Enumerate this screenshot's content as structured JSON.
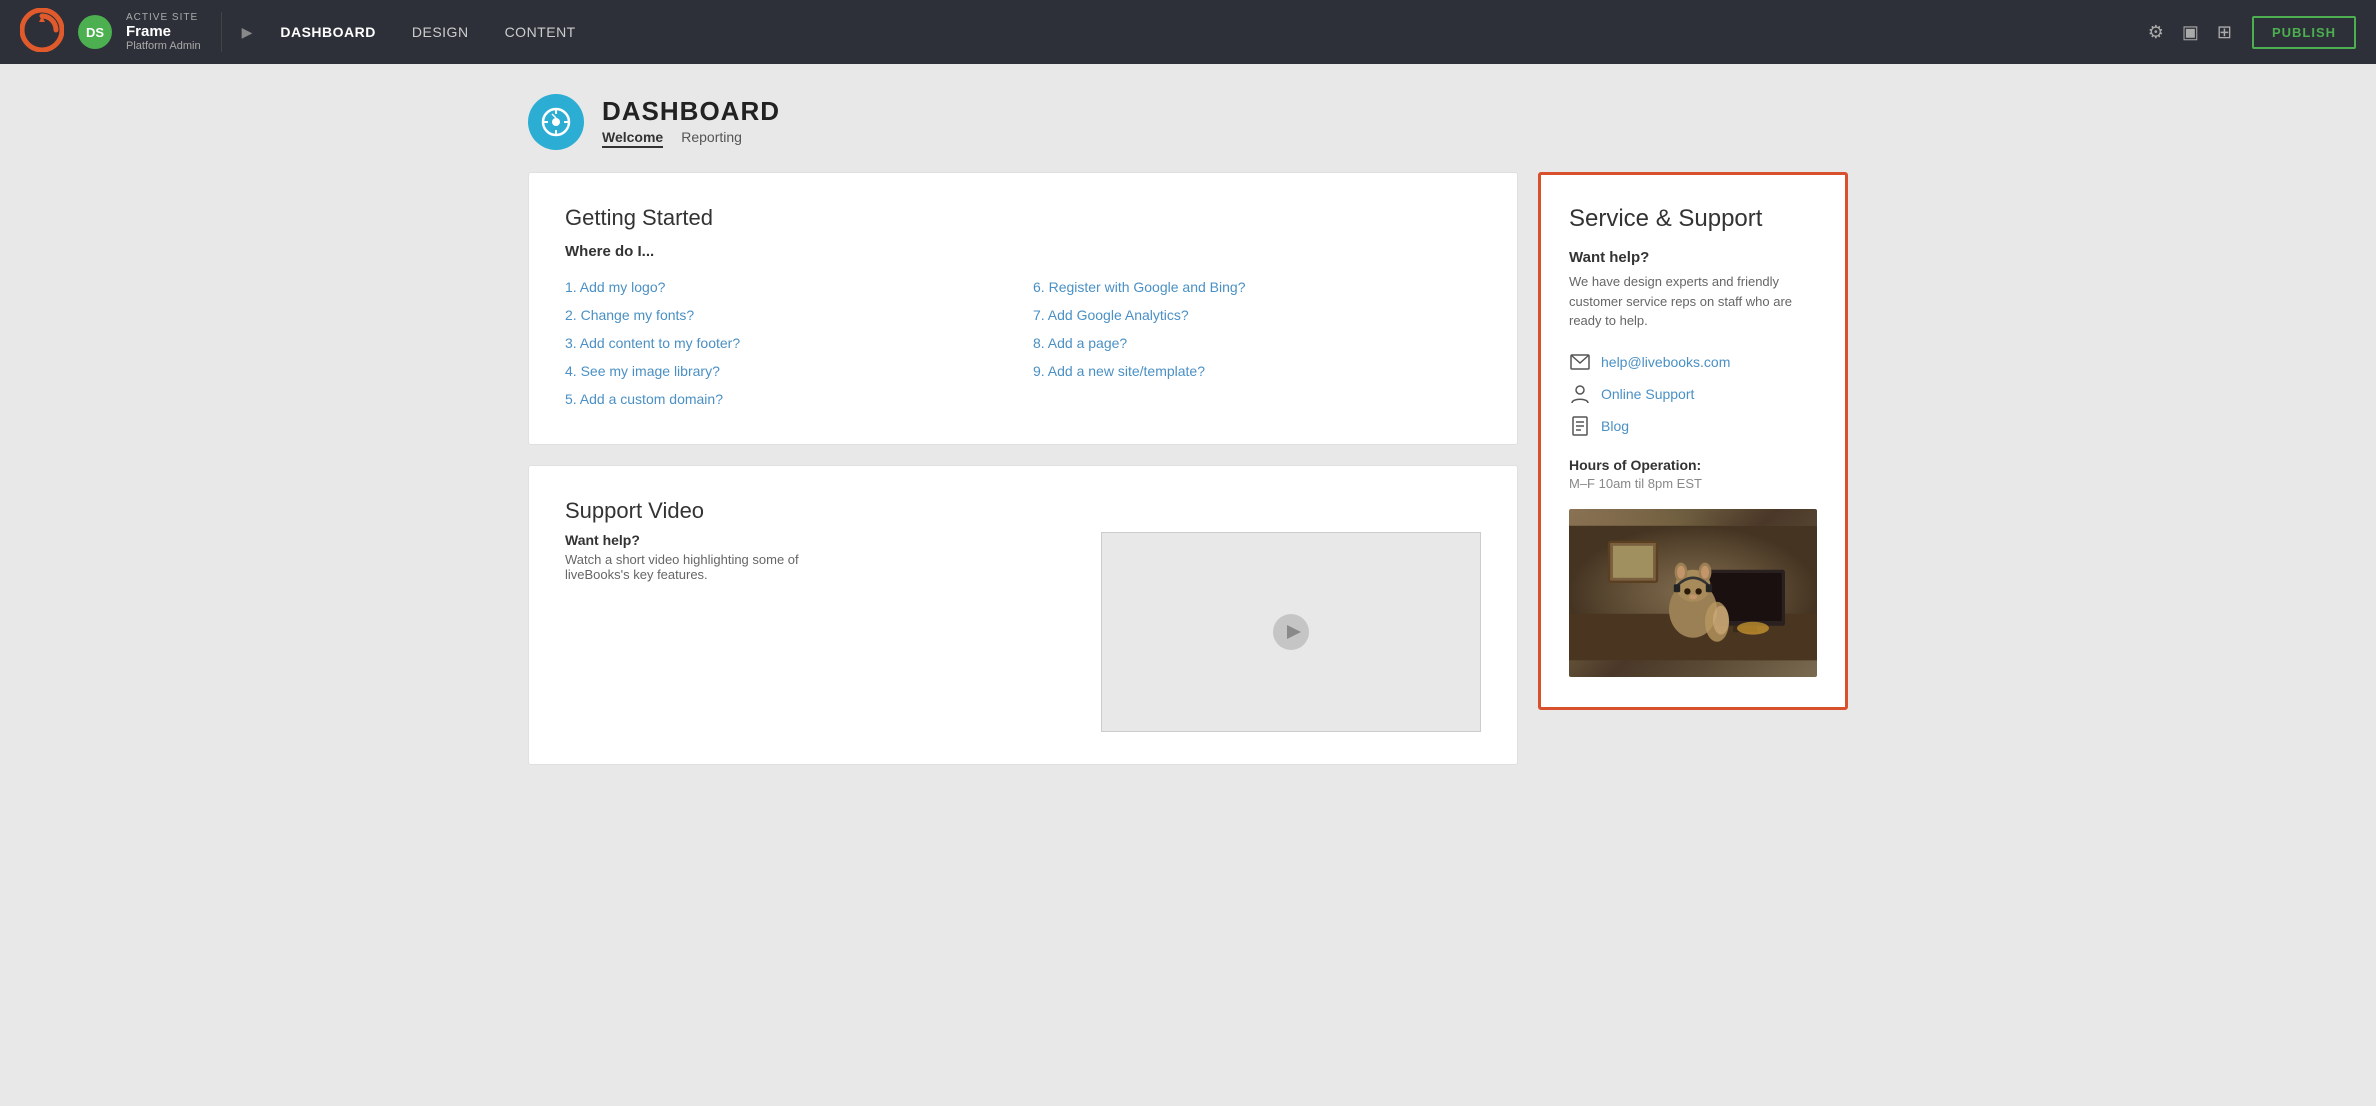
{
  "topnav": {
    "logo_alt": "LiveBooks logo",
    "active_label": "ACTIVE SITE",
    "site_name": "Frame",
    "site_role": "Platform Admin",
    "avatar_initials": "DS",
    "nav_links": [
      {
        "label": "DASHBOARD",
        "active": true
      },
      {
        "label": "DESIGN",
        "active": false
      },
      {
        "label": "CONTENT",
        "active": false
      }
    ],
    "publish_label": "PUBLISH",
    "play_icon": "▶"
  },
  "dashboard_header": {
    "icon_symbol": "✦",
    "title": "DASHBOARD",
    "tabs": [
      {
        "label": "Welcome",
        "active": true
      },
      {
        "label": "Reporting",
        "active": false
      }
    ]
  },
  "getting_started": {
    "title": "Getting Started",
    "where_label": "Where do I...",
    "links_col1": [
      {
        "num": "1.",
        "text": "Add my logo?"
      },
      {
        "num": "2.",
        "text": "Change my fonts?"
      },
      {
        "num": "3.",
        "text": "Add content to my footer?"
      },
      {
        "num": "4.",
        "text": "See my image library?"
      },
      {
        "num": "5.",
        "text": "Add a custom domain?"
      }
    ],
    "links_col2": [
      {
        "num": "6.",
        "text": "Register with Google and Bing?"
      },
      {
        "num": "7.",
        "text": "Add Google Analytics?"
      },
      {
        "num": "8.",
        "text": "Add a page?"
      },
      {
        "num": "9.",
        "text": "Add a new site/template?"
      }
    ]
  },
  "support_video": {
    "title": "Support Video",
    "want_help_label": "Want help?",
    "description": "Watch a short video highlighting some of liveBooks's key features."
  },
  "service_support": {
    "title": "Service & Support",
    "want_help_label": "Want help?",
    "description": "We have design experts and friendly customer service reps on staff who are ready to help.",
    "links": [
      {
        "icon": "✉",
        "text": "help@livebooks.com",
        "type": "email"
      },
      {
        "icon": "👤",
        "text": "Online Support",
        "type": "link"
      },
      {
        "icon": "📋",
        "text": "Blog",
        "type": "link"
      }
    ],
    "hours_title": "Hours of Operation:",
    "hours_text": "M–F 10am til 8pm EST",
    "image_alt": "Squirrel at computer"
  }
}
